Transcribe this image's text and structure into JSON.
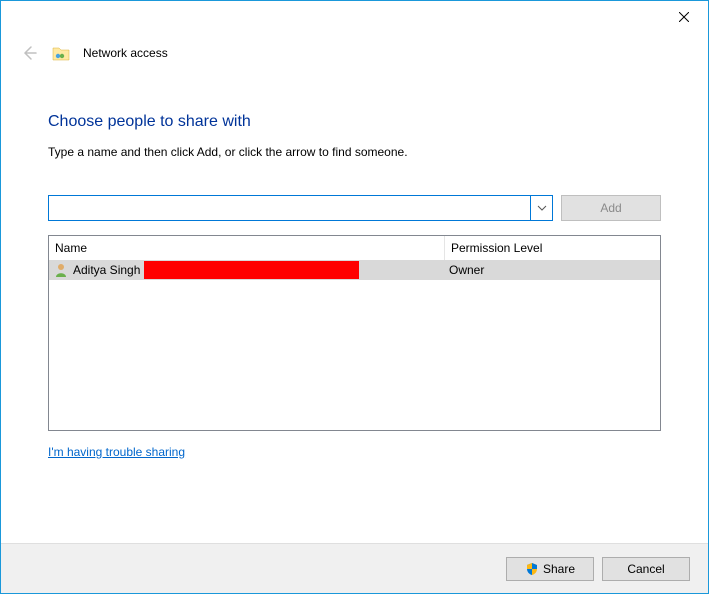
{
  "header": {
    "title": "Network access"
  },
  "main": {
    "heading": "Choose people to share with",
    "subtext": "Type a name and then click Add, or click the arrow to find someone.",
    "name_input_value": "",
    "add_label": "Add",
    "columns": {
      "name": "Name",
      "permission": "Permission Level"
    },
    "rows": [
      {
        "name": "Aditya Singh",
        "permission": "Owner"
      }
    ],
    "trouble_link": "I'm having trouble sharing"
  },
  "footer": {
    "share_label": "Share",
    "cancel_label": "Cancel"
  }
}
